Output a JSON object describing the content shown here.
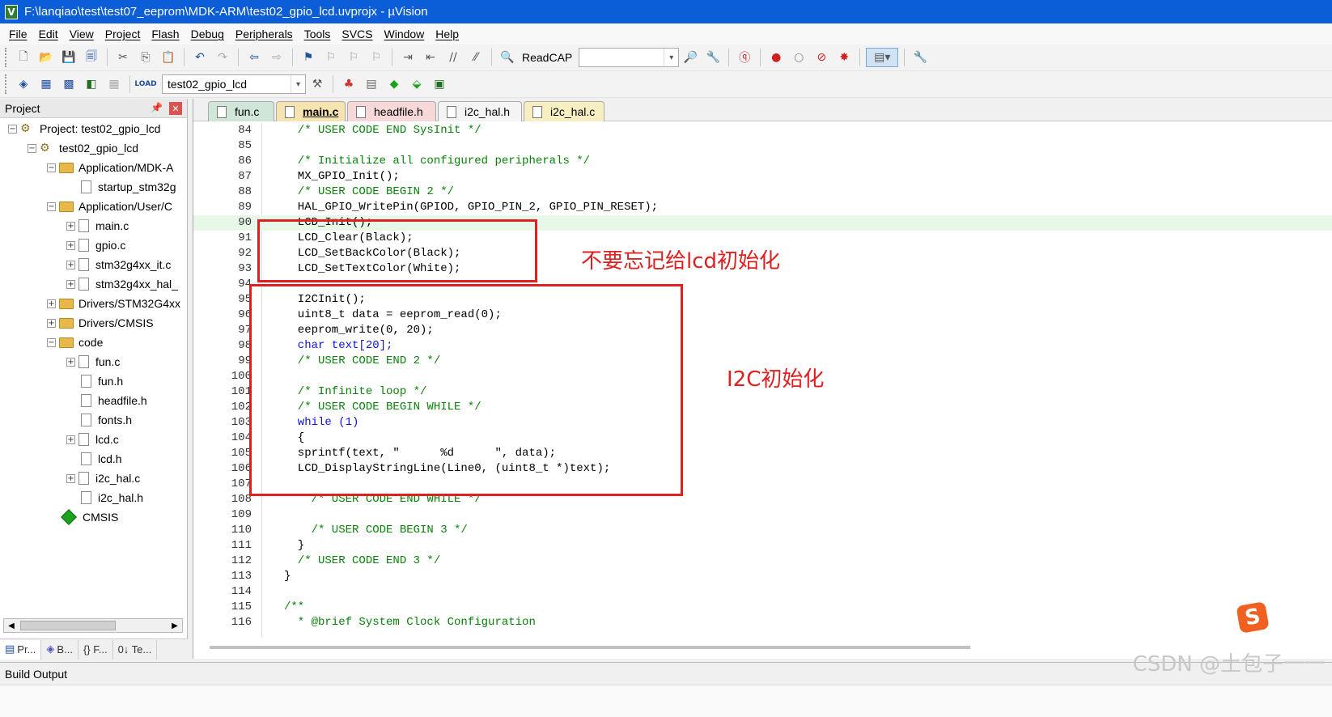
{
  "window": {
    "title": "F:\\lanqiao\\test\\test07_eeprom\\MDK-ARM\\test02_gpio_lcd.uvprojx - µVision",
    "app_icon": "V"
  },
  "menu": [
    "File",
    "Edit",
    "View",
    "Project",
    "Flash",
    "Debug",
    "Peripherals",
    "Tools",
    "SVCS",
    "Window",
    "Help"
  ],
  "toolbar1": {
    "readcap_label": "ReadCAP"
  },
  "toolbar2": {
    "target_value": "test02_gpio_lcd",
    "load_label": "LOAD"
  },
  "project_panel": {
    "title": "Project",
    "items": [
      {
        "label": "Project: test02_gpio_lcd",
        "type": "project",
        "expander": "−"
      },
      {
        "label": "test02_gpio_lcd",
        "type": "target",
        "expander": "−"
      },
      {
        "label": "Application/MDK-A",
        "type": "folder",
        "expander": "−"
      },
      {
        "label": "startup_stm32g",
        "type": "file",
        "expander": ""
      },
      {
        "label": "Application/User/C",
        "type": "folder",
        "expander": "−"
      },
      {
        "label": "main.c",
        "type": "file",
        "expander": "+"
      },
      {
        "label": "gpio.c",
        "type": "file",
        "expander": "+"
      },
      {
        "label": "stm32g4xx_it.c",
        "type": "file",
        "expander": "+"
      },
      {
        "label": "stm32g4xx_hal_",
        "type": "file",
        "expander": "+"
      },
      {
        "label": "Drivers/STM32G4xx",
        "type": "folder",
        "expander": "+"
      },
      {
        "label": "Drivers/CMSIS",
        "type": "folder",
        "expander": "+"
      },
      {
        "label": "code",
        "type": "folder",
        "expander": "−"
      },
      {
        "label": "fun.c",
        "type": "file",
        "expander": "+"
      },
      {
        "label": "fun.h",
        "type": "file",
        "expander": ""
      },
      {
        "label": "headfile.h",
        "type": "file",
        "expander": ""
      },
      {
        "label": "fonts.h",
        "type": "file",
        "expander": ""
      },
      {
        "label": "lcd.c",
        "type": "file",
        "expander": "+"
      },
      {
        "label": "lcd.h",
        "type": "file",
        "expander": ""
      },
      {
        "label": "i2c_hal.c",
        "type": "file",
        "expander": "+"
      },
      {
        "label": "i2c_hal.h",
        "type": "file",
        "expander": ""
      },
      {
        "label": "CMSIS",
        "type": "component",
        "expander": ""
      }
    ],
    "bottom_tabs": [
      "Pr...",
      "B...",
      "{} F...",
      "0↓ Te..."
    ]
  },
  "editor": {
    "tabs": [
      "fun.c",
      "main.c",
      "headfile.h",
      "i2c_hal.h",
      "i2c_hal.c"
    ],
    "active_tab": "main.c",
    "lines": [
      {
        "n": "84",
        "t": "  /* USER CODE END SysInit */"
      },
      {
        "n": "85",
        "t": ""
      },
      {
        "n": "86",
        "t": "  /* Initialize all configured peripherals */"
      },
      {
        "n": "87",
        "t": "  MX_GPIO_Init();"
      },
      {
        "n": "88",
        "t": "  /* USER CODE BEGIN 2 */"
      },
      {
        "n": "89",
        "t": "  HAL_GPIO_WritePin(GPIOD, GPIO_PIN_2, GPIO_PIN_RESET);"
      },
      {
        "n": "90",
        "t": "  LCD_Init();"
      },
      {
        "n": "91",
        "t": "  LCD_Clear(Black);"
      },
      {
        "n": "92",
        "t": "  LCD_SetBackColor(Black);"
      },
      {
        "n": "93",
        "t": "  LCD_SetTextColor(White);"
      },
      {
        "n": "94",
        "t": ""
      },
      {
        "n": "95",
        "t": "  I2CInit();"
      },
      {
        "n": "96",
        "t": "  uint8_t data = eeprom_read(0);"
      },
      {
        "n": "97",
        "t": "  eeprom_write(0, 20);"
      },
      {
        "n": "98",
        "t": "  char text[20];"
      },
      {
        "n": "99",
        "t": "  /* USER CODE END 2 */"
      },
      {
        "n": "100",
        "t": ""
      },
      {
        "n": "101",
        "t": "  /* Infinite loop */"
      },
      {
        "n": "102",
        "t": "  /* USER CODE BEGIN WHILE */"
      },
      {
        "n": "103",
        "t": "  while (1)"
      },
      {
        "n": "104",
        "t": "  {"
      },
      {
        "n": "105",
        "t": "  sprintf(text, \"      %d      \", data);"
      },
      {
        "n": "106",
        "t": "  LCD_DisplayStringLine(Line0, (uint8_t *)text);"
      },
      {
        "n": "107",
        "t": ""
      },
      {
        "n": "108",
        "t": "    /* USER CODE END WHILE */"
      },
      {
        "n": "109",
        "t": ""
      },
      {
        "n": "110",
        "t": "    /* USER CODE BEGIN 3 */"
      },
      {
        "n": "111",
        "t": "  }"
      },
      {
        "n": "112",
        "t": "  /* USER CODE END 3 */"
      },
      {
        "n": "113",
        "t": "}"
      },
      {
        "n": "114",
        "t": ""
      },
      {
        "n": "115",
        "t": "/**"
      },
      {
        "n": "116",
        "t": "  * @brief System Clock Configuration"
      }
    ],
    "highlighted_line": "90"
  },
  "annotations": {
    "lcd_init_note": "不要忘记给lcd初始化",
    "i2c_init_note": "I2C初始化",
    "color": "#e02020"
  },
  "build_output": {
    "label": "Build Output"
  },
  "watermark": "CSDN @土包子一一"
}
